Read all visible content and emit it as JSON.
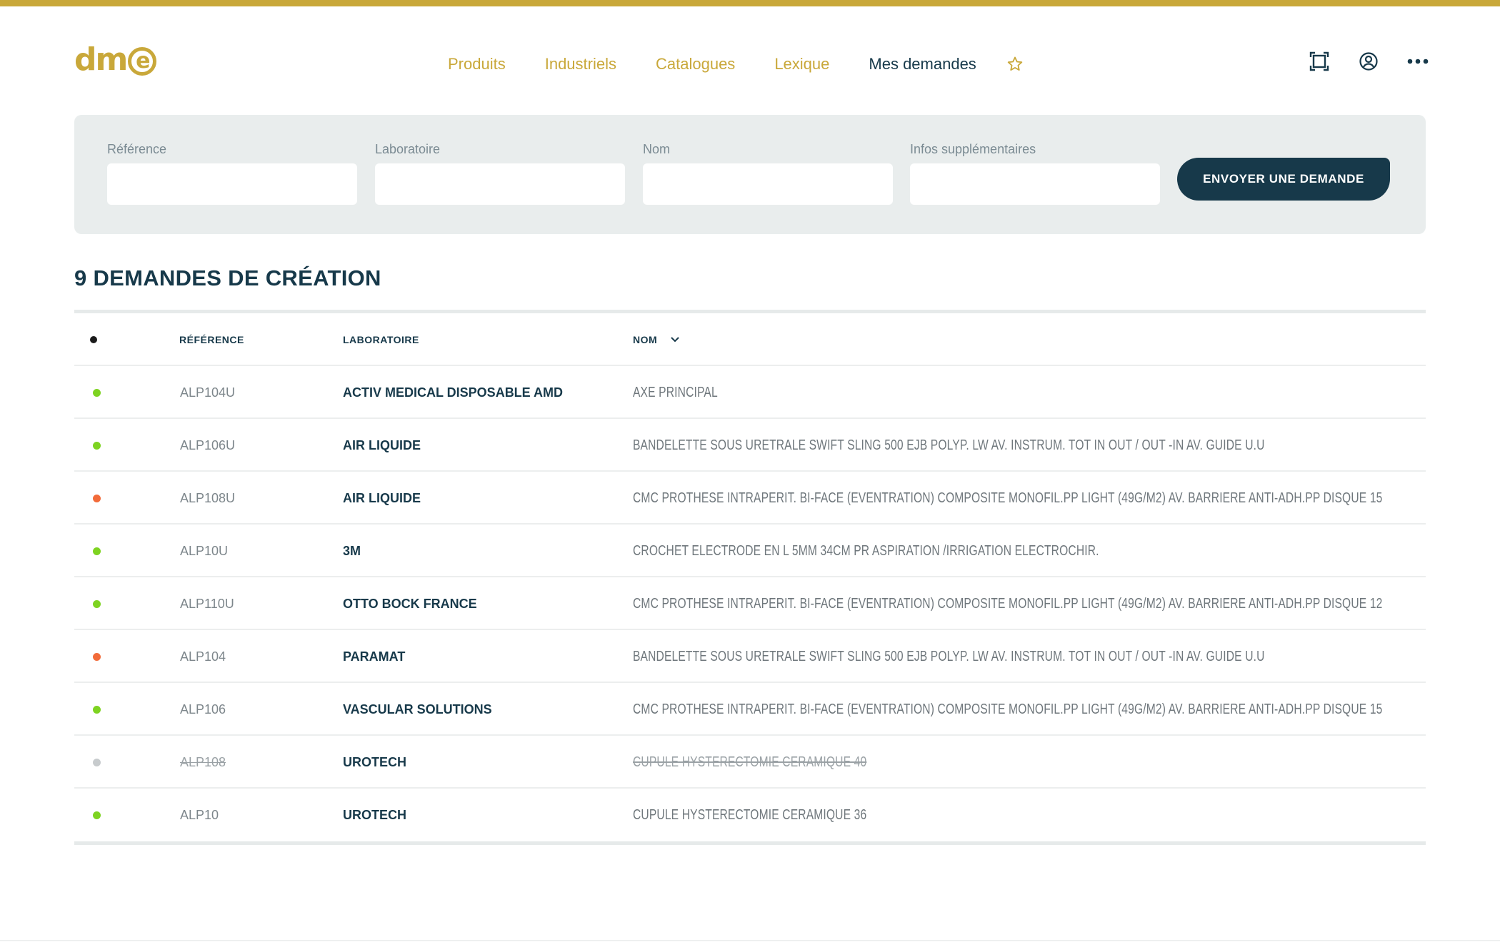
{
  "brand": {
    "logo_text": "dm",
    "logo_mark": "e",
    "accent": "#c9a83a",
    "primary": "#17394a"
  },
  "nav": {
    "items": [
      {
        "label": "Produits",
        "active": false
      },
      {
        "label": "Industriels",
        "active": false
      },
      {
        "label": "Catalogues",
        "active": false
      },
      {
        "label": "Lexique",
        "active": false
      },
      {
        "label": "Mes demandes",
        "active": true
      }
    ],
    "favorite_icon": "star-icon"
  },
  "header_icons": [
    "fullscreen-icon",
    "user-icon",
    "more-icon"
  ],
  "form": {
    "fields": [
      {
        "label": "Référence",
        "value": ""
      },
      {
        "label": "Laboratoire",
        "value": ""
      },
      {
        "label": "Nom",
        "value": ""
      },
      {
        "label": "Infos supplémentaires",
        "value": ""
      }
    ],
    "submit_label": "ENVOYER UNE DEMANDE"
  },
  "section_title": "9 DEMANDES DE CRÉATION",
  "table": {
    "columns": {
      "status": "•",
      "reference": "RÉFÉRENCE",
      "laboratory": "LABORATOIRE",
      "name": "NOM"
    },
    "sort_icon": "chevron-down-icon",
    "status_colors": {
      "green": "#7ed321",
      "orange": "#f26b3a",
      "grey": "#c7cbcd",
      "header": "#1a1a1a"
    },
    "rows": [
      {
        "status": "green",
        "reference": "ALP104U",
        "laboratory": "ACTIV MEDICAL DISPOSABLE AMD",
        "name": "AXE PRINCIPAL"
      },
      {
        "status": "green",
        "reference": "ALP106U",
        "laboratory": "AIR LIQUIDE",
        "name": "BANDELETTE SOUS URETRALE SWIFT SLING 500 EJB POLYP. LW AV. INSTRUM. TOT IN OUT / OUT -IN AV. GUIDE U.U"
      },
      {
        "status": "orange",
        "reference": "ALP108U",
        "laboratory": "AIR LIQUIDE",
        "name": "CMC PROTHESE INTRAPERIT. BI-FACE (EVENTRATION) COMPOSITE MONOFIL.PP LIGHT (49G/M2) AV. BARRIERE ANTI-ADH.PP DISQUE 15"
      },
      {
        "status": "green",
        "reference": "ALP10U",
        "laboratory": "3M",
        "name": "CROCHET ELECTRODE EN L 5MM 34CM PR ASPIRATION /IRRIGATION ELECTROCHIR."
      },
      {
        "status": "green",
        "reference": "ALP110U",
        "laboratory": "OTTO BOCK FRANCE",
        "name": "CMC PROTHESE INTRAPERIT. BI-FACE (EVENTRATION) COMPOSITE MONOFIL.PP LIGHT (49G/M2) AV. BARRIERE ANTI-ADH.PP DISQUE 12"
      },
      {
        "status": "orange",
        "reference": "ALP104",
        "laboratory": "PARAMAT",
        "name": "BANDELETTE SOUS URETRALE SWIFT SLING 500 EJB POLYP. LW AV. INSTRUM. TOT IN OUT / OUT -IN AV. GUIDE U.U"
      },
      {
        "status": "green",
        "reference": "ALP106",
        "laboratory": "VASCULAR SOLUTIONS",
        "name": "CMC PROTHESE INTRAPERIT. BI-FACE (EVENTRATION) COMPOSITE MONOFIL.PP LIGHT (49G/M2) AV. BARRIERE ANTI-ADH.PP DISQUE 15"
      },
      {
        "status": "grey",
        "cancelled": true,
        "reference": "ALP108",
        "laboratory": "UROTECH",
        "name": "CUPULE HYSTERECTOMIE CERAMIQUE 40"
      },
      {
        "status": "green",
        "reference": "ALP10",
        "laboratory": "UROTECH",
        "name": "CUPULE HYSTERECTOMIE CERAMIQUE 36"
      }
    ]
  }
}
